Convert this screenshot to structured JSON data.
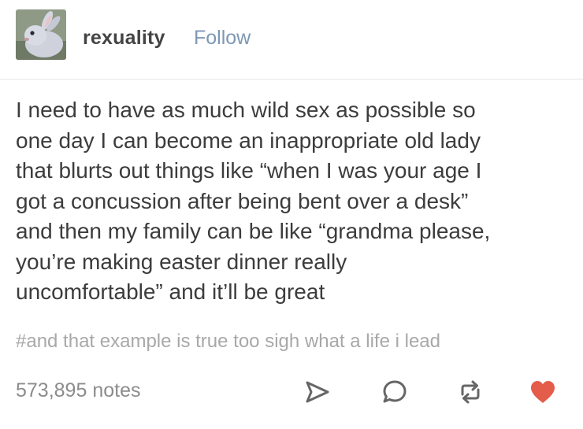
{
  "post": {
    "blog_name": "rexuality",
    "follow_label": "Follow",
    "avatar_icon": "bunny-avatar-icon",
    "body_lines": [
      "I need to have as much wild sex as possible so",
      "one day I can become an inappropriate old lady",
      "that blurts out things like “when I was your age I",
      "got a concussion after being bent over a desk”",
      "and then my family can be like “grandma please,",
      "you’re making easter dinner really",
      "uncomfortable” and it’ll be great"
    ],
    "tags": "#and that example is true too sigh what a life i lead",
    "notes": "573,895 notes",
    "actions": {
      "share_icon": "share-icon",
      "reply_icon": "reply-icon",
      "reblog_icon": "reblog-icon",
      "like_icon": "heart-icon"
    }
  },
  "colors": {
    "text": "#3c3c3c",
    "follow_link": "#7d98b5",
    "tags": "#a8a8a8",
    "notes": "#8c8c8c",
    "icon": "#666666",
    "like": "#e35d4a"
  }
}
